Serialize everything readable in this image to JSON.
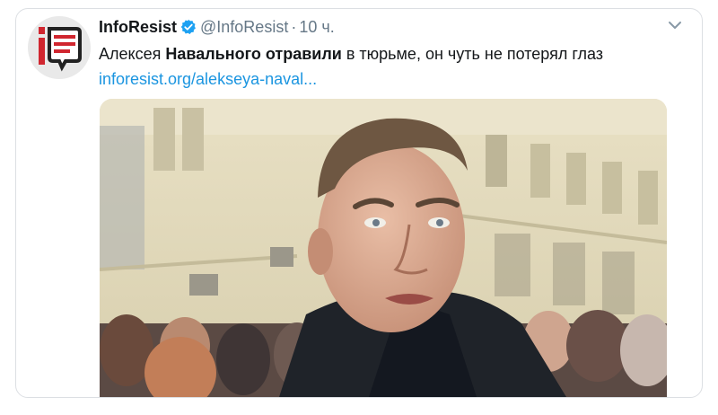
{
  "tweet": {
    "author_name": "InfoResist",
    "handle": "@InfoResist",
    "separator": "·",
    "time": "10 ч.",
    "text_part1": "Алексея ",
    "text_bold1": "Навального",
    "text_part2": " ",
    "text_bold2": "отравили",
    "text_part3": " в тюрьме, он чуть не потерял глаз",
    "link": "inforesist.org/alekseya-naval..."
  },
  "avatar": {
    "icon": "inforesist-logo-icon",
    "brand_color": "#d0262f"
  },
  "colors": {
    "link": "#1b95e0",
    "verified": "#1da1f2",
    "muted": "#657786"
  },
  "media": {
    "icon": "photo-of-man-in-crowd"
  }
}
